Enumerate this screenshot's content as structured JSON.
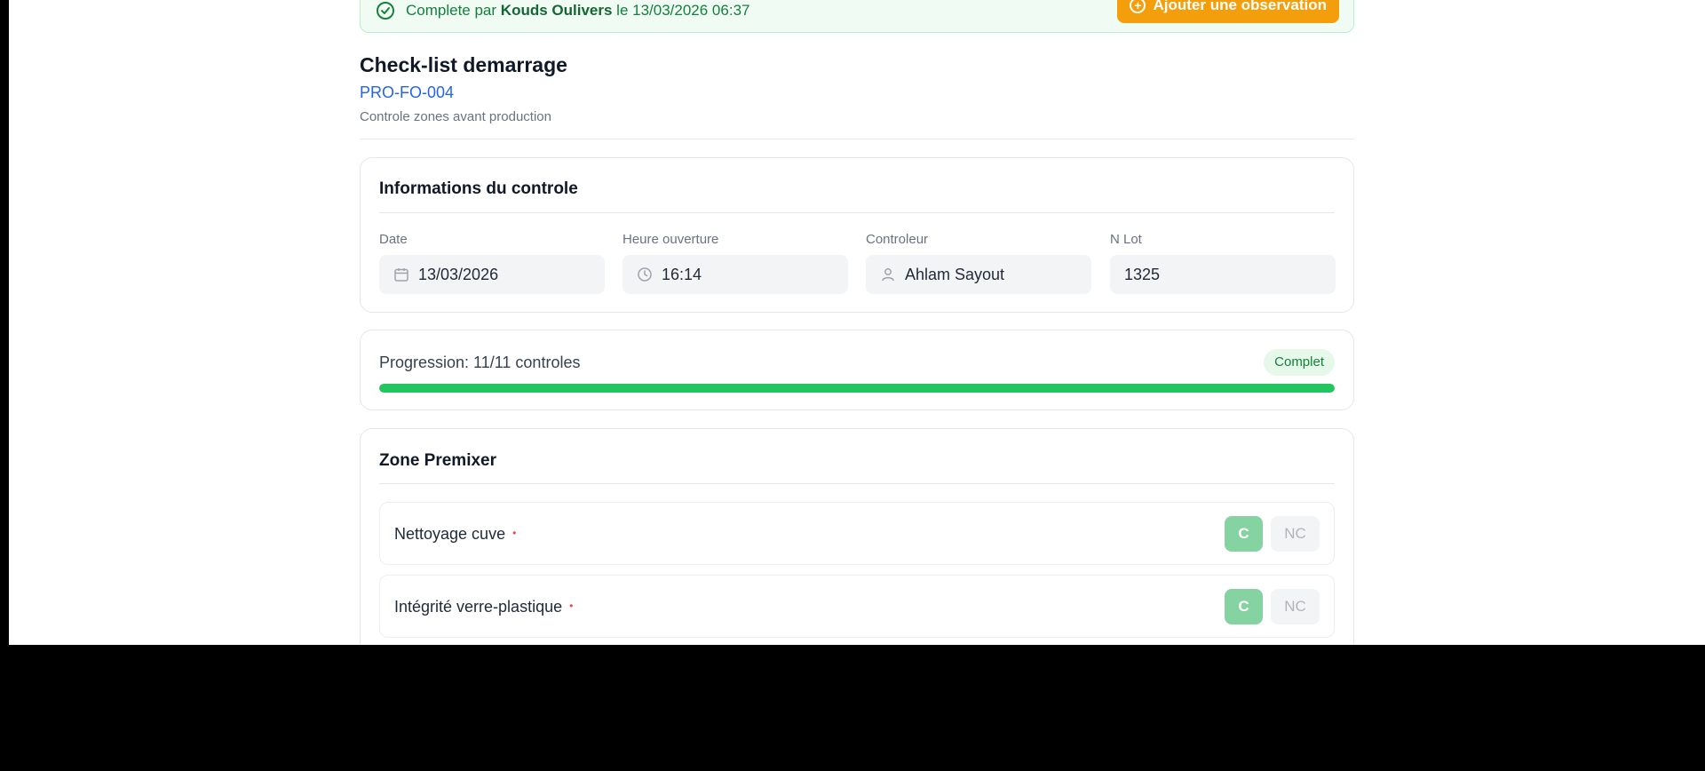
{
  "banner": {
    "prefix": "Complete par",
    "user": "Kouds Oulivers",
    "suffix": "le 13/03/2026 06:37",
    "observation_button": "Ajouter une observation"
  },
  "header": {
    "title": "Check-list demarrage",
    "code": "PRO-FO-004",
    "subtitle": "Controle zones avant production"
  },
  "info": {
    "title": "Informations du controle",
    "fields": [
      {
        "label": "Date",
        "value": "13/03/2026",
        "icon": "calendar-icon"
      },
      {
        "label": "Heure ouverture",
        "value": "16:14",
        "icon": "clock-icon"
      },
      {
        "label": "Controleur",
        "value": "Ahlam Sayout",
        "icon": "user-icon"
      },
      {
        "label": "N Lot",
        "value": "1325",
        "icon": ""
      }
    ]
  },
  "progress": {
    "text": "Progression: 11/11 controles",
    "badge": "Complet",
    "percent": 100,
    "color": "#22c55e"
  },
  "zone": {
    "title": "Zone Premixer",
    "items": [
      {
        "label": "Nettoyage cuve",
        "required_mark": "•",
        "c_label": "C",
        "nc_label": "NC",
        "selected": "C"
      },
      {
        "label": "Intégrité verre-plastique",
        "required_mark": "•",
        "c_label": "C",
        "nc_label": "NC",
        "selected": "C"
      }
    ]
  },
  "colors": {
    "accent_orange": "#f59e0b",
    "success_green": "#22c55e",
    "link_blue": "#2563eb"
  }
}
